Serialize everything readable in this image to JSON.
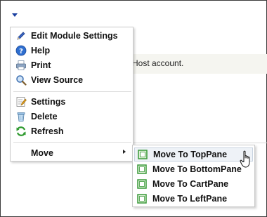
{
  "background": {
    "text": "Host account."
  },
  "menu": {
    "items": [
      {
        "label": "Edit Module Settings",
        "icon": "pencil-icon"
      },
      {
        "label": "Help",
        "icon": "help-icon"
      },
      {
        "label": "Print",
        "icon": "printer-icon"
      },
      {
        "label": "View Source",
        "icon": "magnifier-icon"
      },
      {
        "label": "Settings",
        "icon": "settings-icon"
      },
      {
        "label": "Delete",
        "icon": "trash-icon"
      },
      {
        "label": "Refresh",
        "icon": "refresh-icon"
      },
      {
        "label": "Move",
        "icon": ""
      }
    ]
  },
  "submenu": {
    "items": [
      {
        "label": "Move To TopPane",
        "icon": "pane-icon"
      },
      {
        "label": "Move To BottomPane",
        "icon": "pane-icon"
      },
      {
        "label": "Move To CartPane",
        "icon": "pane-icon"
      },
      {
        "label": "Move To LeftPane",
        "icon": "pane-icon"
      }
    ]
  },
  "colors": {
    "trigger": "#1a3fa0",
    "pane_icon": "#3a9a3a",
    "hover_bg": "#eef2f7"
  }
}
